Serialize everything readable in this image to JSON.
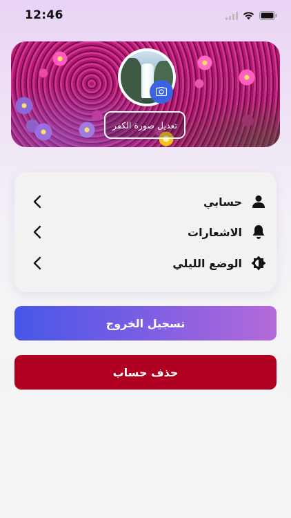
{
  "status_bar": {
    "time": "12:46"
  },
  "profile": {
    "edit_cover_label": "تعديل صورة الكفر",
    "camera_icon": "camera-icon"
  },
  "settings": {
    "items": [
      {
        "label": "حسابي",
        "icon": "person-icon"
      },
      {
        "label": "الاشعارات",
        "icon": "bell-icon"
      },
      {
        "label": "الوضع الليلي",
        "icon": "brightness-icon"
      }
    ]
  },
  "actions": {
    "logout_label": "تسجيل الخروج",
    "delete_account_label": "حذف حساب"
  },
  "colors": {
    "accent_blue": "#3a63e6",
    "logout_gradient_start": "#4757e8",
    "logout_gradient_end": "#b56ad9",
    "delete_red": "#b00021"
  }
}
